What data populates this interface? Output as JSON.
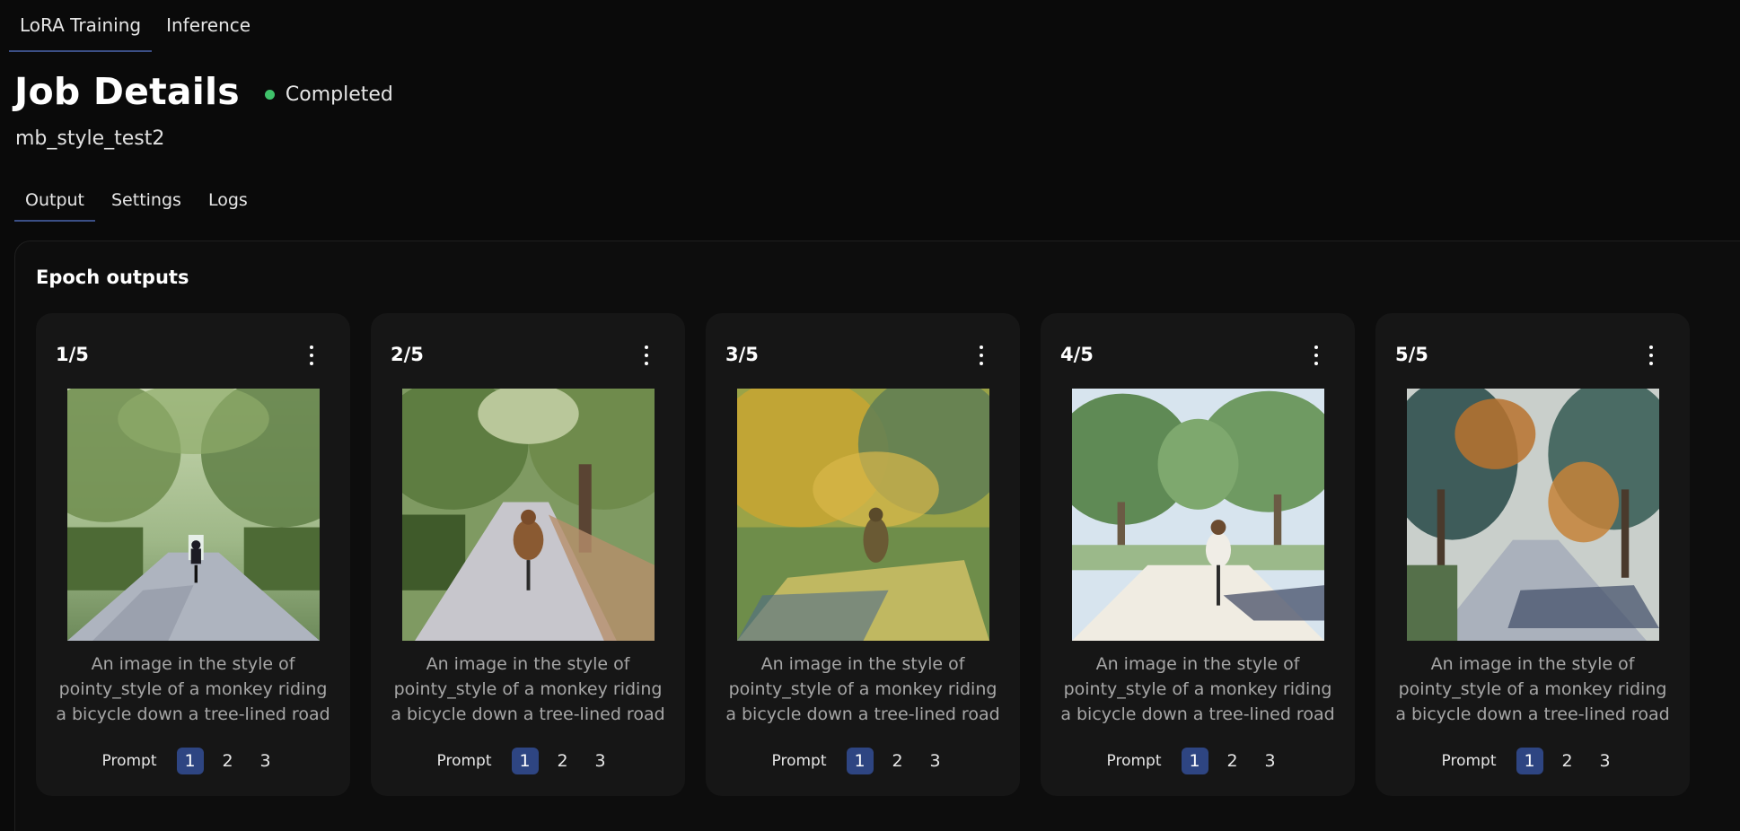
{
  "top_tabs": [
    {
      "label": "LoRA Training",
      "active": true
    },
    {
      "label": "Inference",
      "active": false
    }
  ],
  "header": {
    "title": "Job Details",
    "status": "Completed",
    "status_color": "#3fc26a",
    "job_name": "mb_style_test2"
  },
  "sub_tabs": [
    {
      "label": "Output",
      "active": true
    },
    {
      "label": "Settings",
      "active": false
    },
    {
      "label": "Logs",
      "active": false
    }
  ],
  "panel": {
    "title": "Epoch outputs",
    "cards": [
      {
        "epoch": "1/5",
        "caption": "An image in the style of pointy_style of a monkey riding a bicycle down a tree-lined road",
        "prompt_label": "Prompt",
        "prompts": [
          "1",
          "2",
          "3"
        ],
        "selected_prompt": "1"
      },
      {
        "epoch": "2/5",
        "caption": "An image in the style of pointy_style of a monkey riding a bicycle down a tree-lined road",
        "prompt_label": "Prompt",
        "prompts": [
          "1",
          "2",
          "3"
        ],
        "selected_prompt": "1"
      },
      {
        "epoch": "3/5",
        "caption": "An image in the style of pointy_style of a monkey riding a bicycle down a tree-lined road",
        "prompt_label": "Prompt",
        "prompts": [
          "1",
          "2",
          "3"
        ],
        "selected_prompt": "1"
      },
      {
        "epoch": "4/5",
        "caption": "An image in the style of pointy_style of a monkey riding a bicycle down a tree-lined road",
        "prompt_label": "Prompt",
        "prompts": [
          "1",
          "2",
          "3"
        ],
        "selected_prompt": "1"
      },
      {
        "epoch": "5/5",
        "caption": "An image in the style of pointy_style of a monkey riding a bicycle down a tree-lined road",
        "prompt_label": "Prompt",
        "prompts": [
          "1",
          "2",
          "3"
        ],
        "selected_prompt": "1"
      }
    ]
  }
}
